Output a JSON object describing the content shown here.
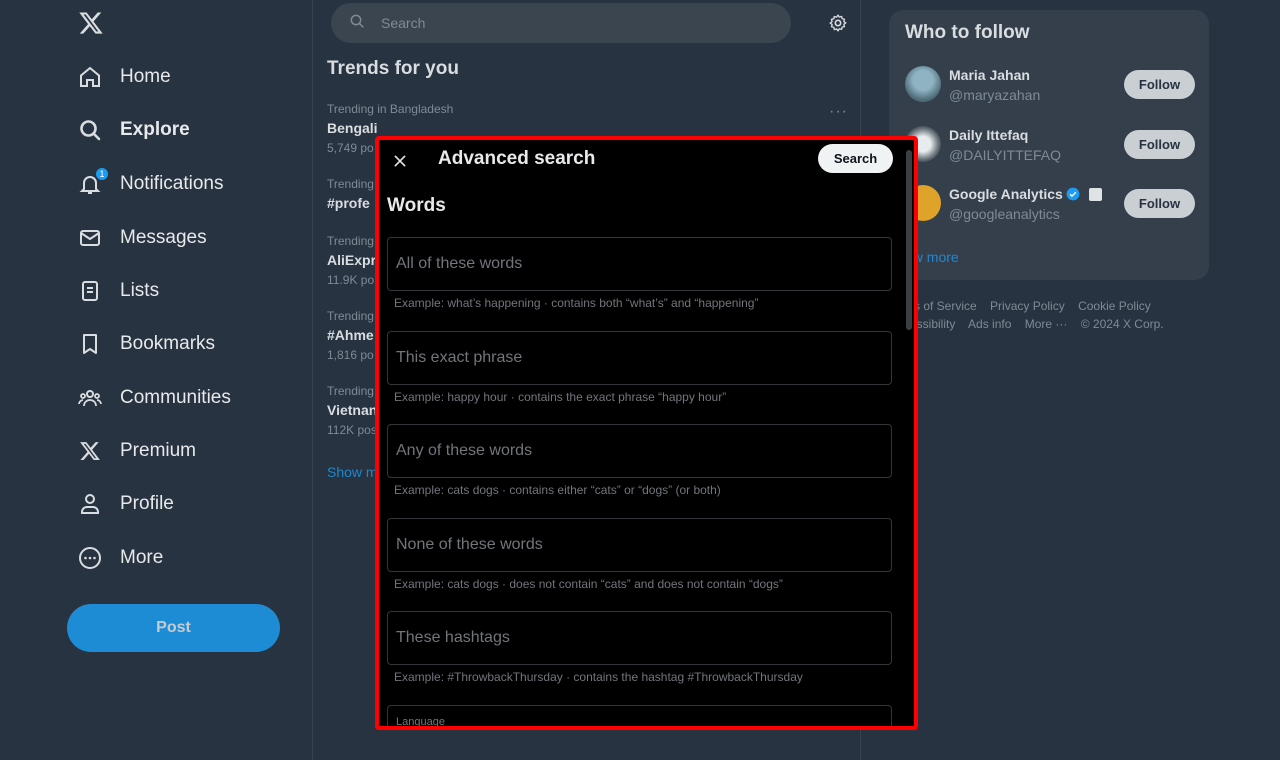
{
  "sidebar": {
    "logo": "x-logo-icon",
    "items": [
      {
        "label": "Home",
        "icon": "home-icon"
      },
      {
        "label": "Explore",
        "icon": "search-icon",
        "active": true
      },
      {
        "label": "Notifications",
        "icon": "bell-icon",
        "badge": "1"
      },
      {
        "label": "Messages",
        "icon": "envelope-icon"
      },
      {
        "label": "Lists",
        "icon": "list-icon"
      },
      {
        "label": "Bookmarks",
        "icon": "bookmark-icon"
      },
      {
        "label": "Communities",
        "icon": "communities-icon"
      },
      {
        "label": "Premium",
        "icon": "x-logo-icon"
      },
      {
        "label": "Profile",
        "icon": "person-icon"
      },
      {
        "label": "More",
        "icon": "more-circle-icon"
      }
    ],
    "post_label": "Post"
  },
  "search": {
    "placeholder": "Search"
  },
  "trends": {
    "title": "Trends for you",
    "items": [
      {
        "context": "Trending in Bangladesh",
        "name": "Bengali",
        "count": "5,749 po"
      },
      {
        "context": "Trending",
        "name": "#profe",
        "count": ""
      },
      {
        "context": "Trending",
        "name": "AliExpr",
        "count": "11.9K po"
      },
      {
        "context": "Trending",
        "name": "#Ahme",
        "count": "1,816 po"
      },
      {
        "context": "Trending",
        "name": "Vietnan",
        "count": "112K pos"
      }
    ],
    "more_dots": "···",
    "show_more": "Show m"
  },
  "who_to_follow": {
    "title": "Who to follow",
    "users": [
      {
        "name": "Maria Jahan",
        "handle": "@maryazahan",
        "follow": "Follow"
      },
      {
        "name": "Daily Ittefaq",
        "handle": "@DAILYITTEFAQ",
        "follow": "Follow"
      },
      {
        "name": "Google Analytics",
        "handle": "@googleanalytics",
        "follow": "Follow",
        "verified": true
      }
    ],
    "show_more": "ow more"
  },
  "footer": {
    "line1": [
      "ms of Service",
      "Privacy Policy",
      "Cookie Policy"
    ],
    "line2": [
      "cessibility",
      "Ads info",
      "More ···",
      "© 2024 X Corp."
    ]
  },
  "modal": {
    "title": "Advanced search",
    "search_button": "Search",
    "section": "Words",
    "fields": [
      {
        "placeholder": "All of these words",
        "example": "Example: what’s happening · contains both “what’s” and “happening”"
      },
      {
        "placeholder": "This exact phrase",
        "example": "Example: happy hour · contains the exact phrase “happy hour”"
      },
      {
        "placeholder": "Any of these words",
        "example": "Example: cats dogs · contains either “cats” or “dogs” (or both)"
      },
      {
        "placeholder": "None of these words",
        "example": "Example: cats dogs · does not contain “cats” and does not contain “dogs”"
      },
      {
        "placeholder": "These hashtags",
        "example": "Example: #ThrowbackThursday · contains the hashtag #ThrowbackThursday"
      }
    ],
    "language_label": "Language"
  },
  "colors": {
    "accent": "#1d9bf0",
    "modal_border": "#ff0000",
    "background": "#273340"
  }
}
